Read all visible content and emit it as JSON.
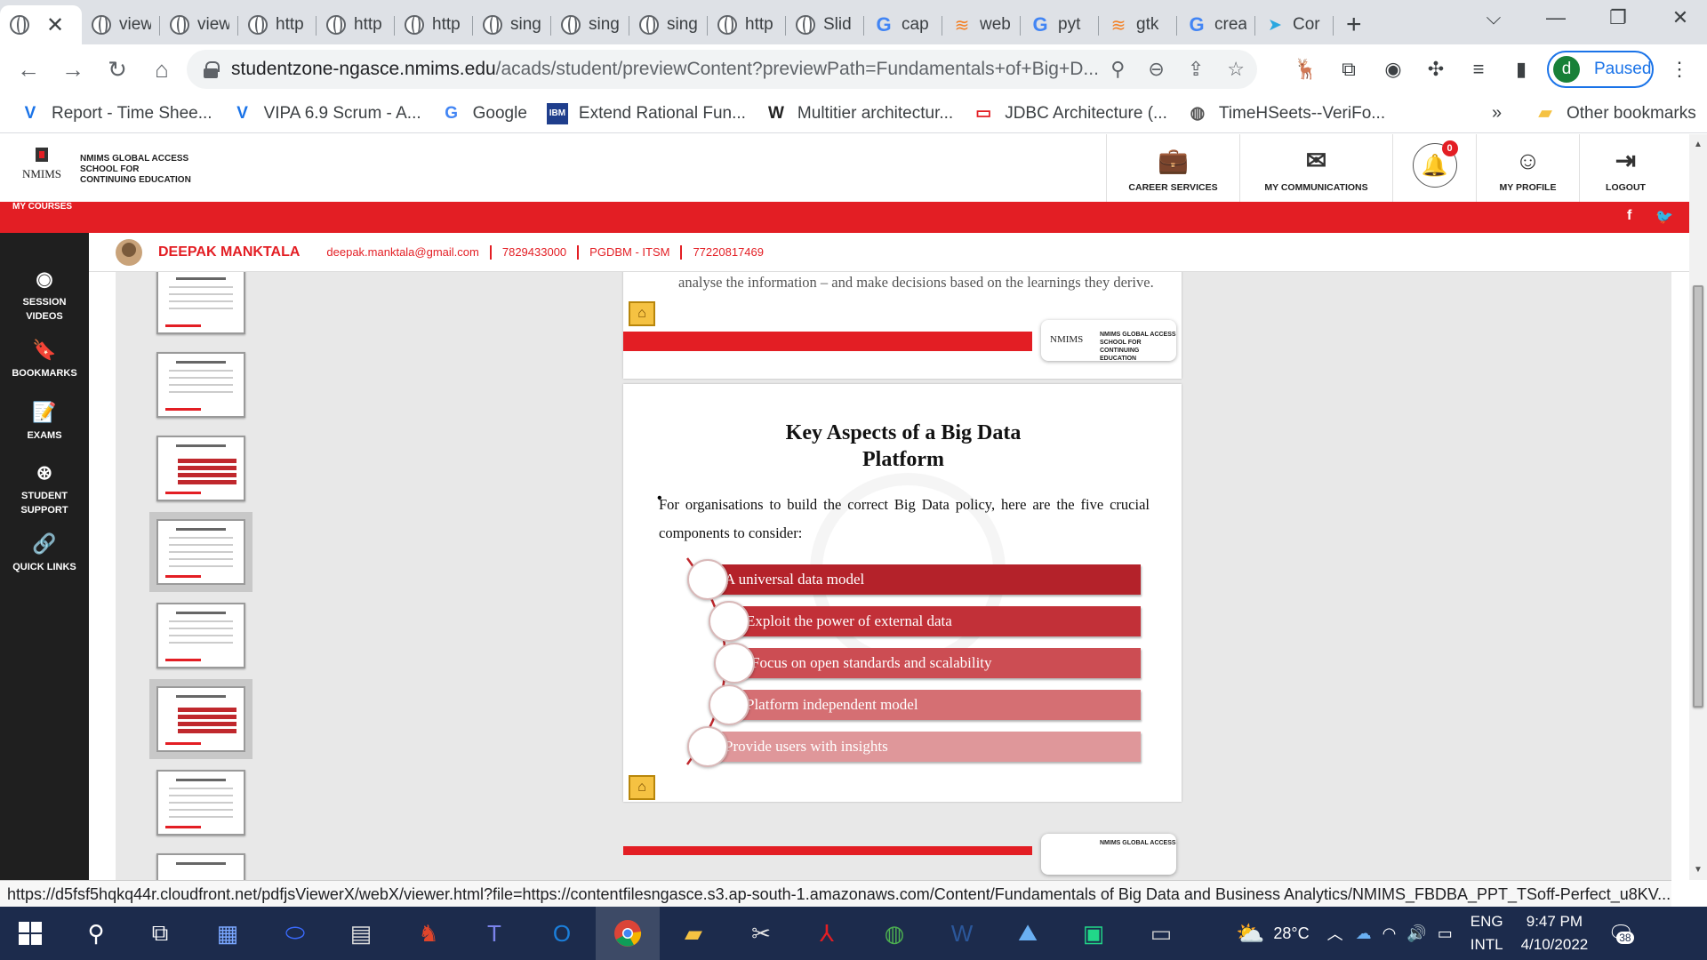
{
  "tabs": [
    {
      "label": "view",
      "icon": "globe-icon"
    },
    {
      "label": "view",
      "icon": "globe-icon"
    },
    {
      "label": "http",
      "icon": "globe-icon"
    },
    {
      "label": "http",
      "icon": "globe-icon"
    },
    {
      "label": "http",
      "icon": "globe-icon"
    },
    {
      "label": "sing",
      "icon": "globe-icon"
    },
    {
      "label": "sing",
      "icon": "globe-icon"
    },
    {
      "label": "sing",
      "icon": "globe-icon"
    },
    {
      "label": "http",
      "icon": "globe-icon"
    },
    {
      "label": "Slid",
      "icon": "globe-icon"
    },
    {
      "label": "cap",
      "icon": "google-icon"
    },
    {
      "label": "web",
      "icon": "stackoverflow-icon"
    },
    {
      "label": "pyt",
      "icon": "google-icon"
    },
    {
      "label": "gtk",
      "icon": "stackoverflow-icon"
    },
    {
      "label": "crea",
      "icon": "google-icon"
    },
    {
      "label": "Cor",
      "icon": "fish-icon"
    }
  ],
  "address": {
    "host": "studentzone-ngasce.nmims.edu",
    "path": "/acads/student/previewContent?previewPath=Fundamentals+of+Big+D..."
  },
  "profile": {
    "initial": "d",
    "status": "Paused"
  },
  "bookmarks": [
    {
      "label": "Report - Time Shee...",
      "icon": "V"
    },
    {
      "label": "VIPA 6.9 Scrum - A...",
      "icon": "V"
    },
    {
      "label": "Google",
      "icon": "G"
    },
    {
      "label": "Extend Rational Fun...",
      "icon": "IBM"
    },
    {
      "label": "Multitier architectur...",
      "icon": "W"
    },
    {
      "label": "JDBC Architecture (...",
      "icon": "▭"
    },
    {
      "label": "TimeHSeets--VeriFo...",
      "icon": "◍"
    }
  ],
  "bookmarks_more": "»",
  "other_bookmarks": "Other bookmarks",
  "site": {
    "logo_lines": [
      "NMIMS GLOBAL ACCESS",
      "SCHOOL FOR",
      "CONTINUING EDUCATION"
    ],
    "logo_word": "NMIMS",
    "nav": [
      {
        "label": "CAREER SERVICES",
        "icon": "briefcase-icon"
      },
      {
        "label": "MY COMMUNICATIONS",
        "icon": "envelope-icon"
      },
      {
        "label": "",
        "icon": "bell-icon",
        "badge": "0"
      },
      {
        "label": "MY PROFILE",
        "icon": "user-icon"
      },
      {
        "label": "LOGOUT",
        "icon": "logout-icon"
      }
    ],
    "my_courses": "MY COURSES",
    "social": [
      "f",
      "t"
    ]
  },
  "sidebar": [
    {
      "label": "SESSION VIDEOS",
      "icon": "play-icon"
    },
    {
      "label": "BOOKMARKS",
      "icon": "bookmark-icon"
    },
    {
      "label": "EXAMS",
      "icon": "exam-icon"
    },
    {
      "label": "STUDENT SUPPORT",
      "icon": "support-icon"
    },
    {
      "label": "QUICK LINKS",
      "icon": "link-icon"
    }
  ],
  "user": {
    "name": "DEEPAK MANKTALA",
    "email": "deepak.manktala@gmail.com",
    "phone": "7829433000",
    "program": "PGDBM - ITSM",
    "id": "77220817469"
  },
  "slide_prev_text": "analyse the information – and make decisions based on the learnings they derive.",
  "slide": {
    "title_line1": "Key Aspects of a Big Data",
    "title_line2": "Platform",
    "body": "For organisations to build the correct Big Data policy, here are the five crucial components to consider:",
    "items": [
      "A universal data model",
      "Exploit the power of external data",
      "Focus on open standards and scalability",
      "Platform independent model",
      "Provide users with insights"
    ]
  },
  "status_url": "https://d5fsf5hqkq44r.cloudfront.net/pdfjsViewerX/webX/viewer.html?file=https://contentfilesngasce.s3.ap-south-1.amazonaws.com/Content/Fundamentals of Big Data and Business Analytics/NMIMS_FBDBA_PPT_TSoff-Perfect_u8KV...",
  "taskbar": {
    "weather": "28°C",
    "lang1": "ENG",
    "lang2": "INTL",
    "time": "9:47 PM",
    "date": "4/10/2022",
    "notifications": "38"
  }
}
